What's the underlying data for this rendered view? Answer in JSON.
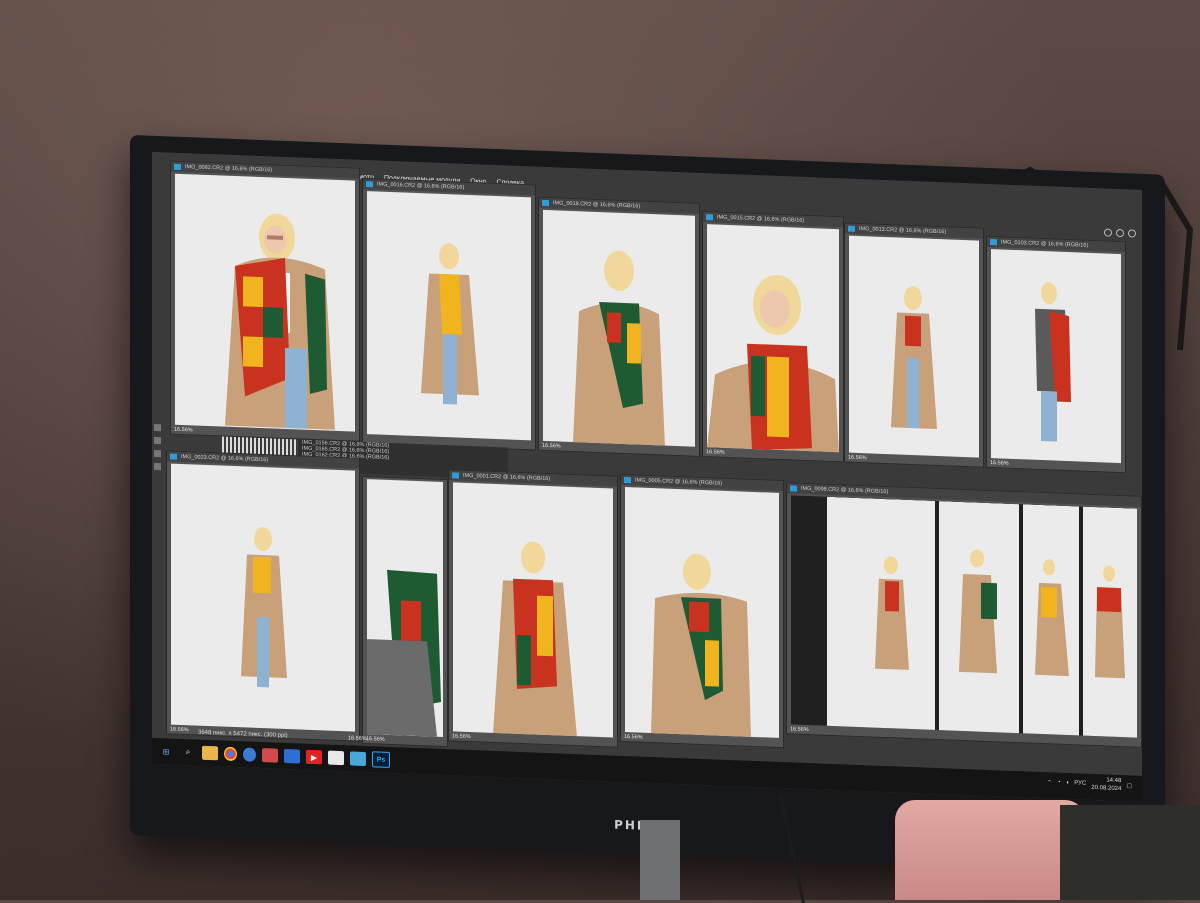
{
  "app": {
    "menu": [
      "Просмотр",
      "Подключаемые модули",
      "Окно",
      "Справка"
    ],
    "status": "3648 пикс. x 5472 пикс. (300 ppi)",
    "brand": "PHILIPS",
    "clock_time": "14:48",
    "clock_date": "20.08.2024",
    "lang": "РУС"
  },
  "windows": [
    {
      "title": "IMG_0082.CR2 @ 16,6% (RGB/16)",
      "zoom": "16.56%"
    },
    {
      "title": "IMG_0016.CR2 @ 16,6% (RGB/16)",
      "zoom": ""
    },
    {
      "title": "IMG_0018.CR2 @ 16,6% (RGB/16)",
      "zoom": "16.56%"
    },
    {
      "title": "IMG_0015.CR2 @ 16,6% (RGB/16)",
      "zoom": "16.56%"
    },
    {
      "title": "IMG_0013.CR2 @ 16,6% (RGB/16)",
      "zoom": "16.56%"
    },
    {
      "title": "IMG_0103.CR2 @ 16,6% (RGB/16)",
      "zoom": "16.56%"
    },
    {
      "title": "IMG_0023.CR2 @ 16,6% (RGB/16)",
      "zoom": "16.56%"
    },
    {
      "title": "IMG_0001.CR2 @ 16,6% (RGB/16)",
      "zoom": "16.56%"
    },
    {
      "title": "IMG_0005.CR2 @ 16,6% (RGB/16)",
      "zoom": "16.56%"
    },
    {
      "title": "IMG_0098.CR2 @ 16,6% (RGB/16)",
      "zoom": "16.56%"
    }
  ],
  "extra_tabs": [
    "IMG_0156.CR2 @ 16,6% (RGB/16)",
    "IMG_0165.CR2 @ 16,6% (RGB/16)",
    "IMG_0162.CR2 @ 16,6% (RGB/16)"
  ],
  "small_zooms": [
    "16.56%",
    "16.56%"
  ],
  "colors": {
    "ps_blue": "#31a8ff",
    "coat": "#c8a07a",
    "scarf_red": "#c8321e",
    "scarf_yellow": "#f0b41e",
    "scarf_green": "#1e5a32",
    "jeans": "#8fb2d2"
  },
  "icons": [
    "start-icon",
    "search-icon",
    "file-explorer-icon",
    "chrome-icon",
    "browser-icon",
    "app-icon",
    "app-icon",
    "youtube-icon",
    "notes-icon",
    "app-icon",
    "photoshop-icon"
  ]
}
